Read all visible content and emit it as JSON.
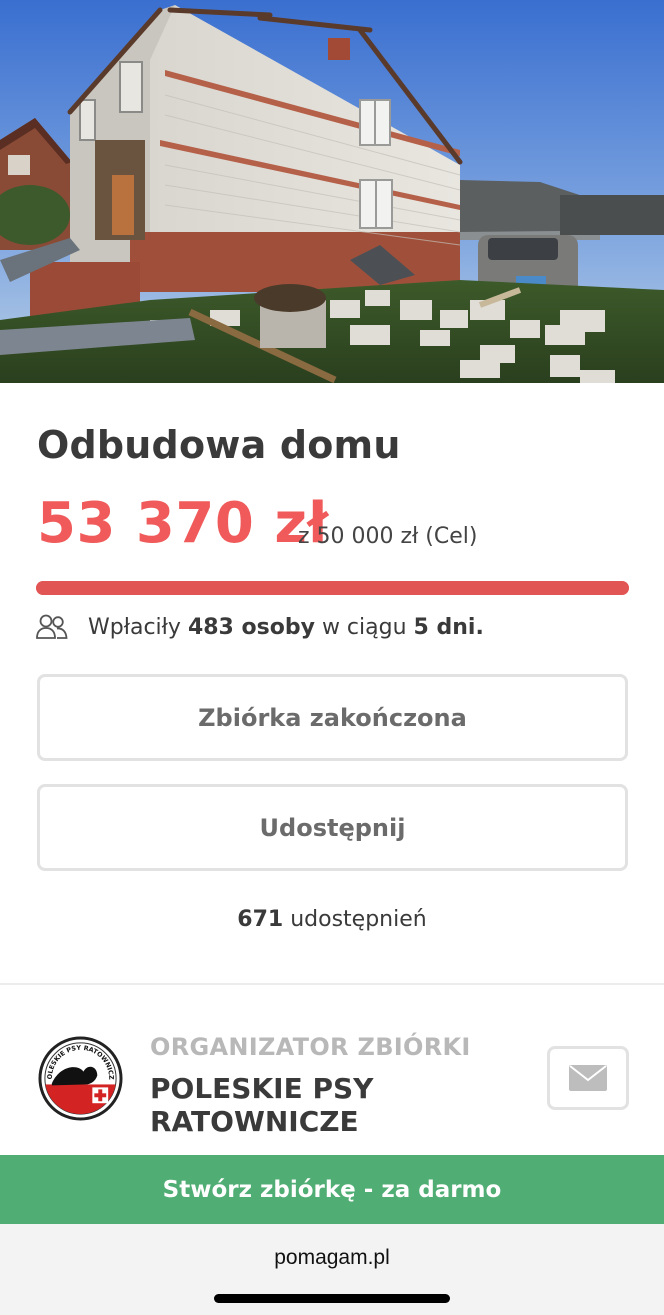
{
  "campaign": {
    "title": "Odbudowa domu",
    "raised": "53 370 zł",
    "goal_text": "z 50 000 zł (Cel)",
    "progress_fraction": 1.0,
    "donors_prefix": "Wpłaciły",
    "donors_count": "483 osoby",
    "donors_middle": "w ciągu",
    "days": "5 dni."
  },
  "buttons": {
    "closed_label": "Zbiórka zakończona",
    "share_label": "Udostępnij"
  },
  "shares": {
    "count": "671",
    "label": "udostępnień"
  },
  "organizer": {
    "label": "ORGANIZATOR ZBIÓRKI",
    "name": "POLESKIE PSY RATOWNICZE",
    "logo_text": "POLESKIE PSY RATOWNICZE"
  },
  "cta": {
    "label": "Stwórz zbiórkę - za darmo"
  },
  "browser": {
    "url": "pomagam.pl"
  },
  "icons": {
    "donors": "people-icon",
    "mail": "envelope-icon"
  },
  "colors": {
    "accent": "#f05a5a",
    "cta": "#50ad74",
    "border": "#e2e2e2"
  }
}
